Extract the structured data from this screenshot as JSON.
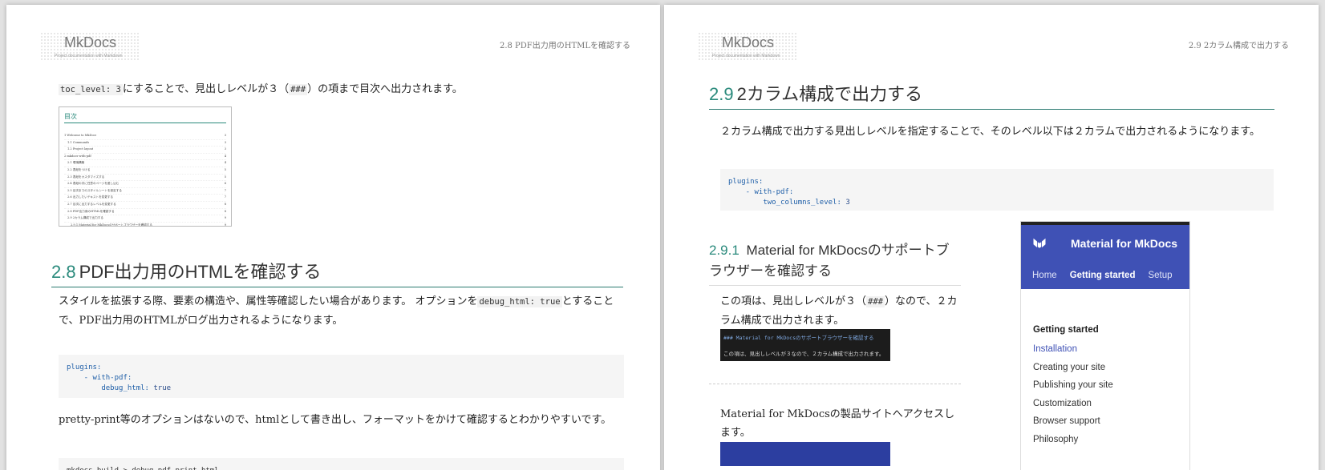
{
  "left_page": {
    "logo": {
      "title": "MkDocs",
      "subtitle": "Project documentation with Markdown"
    },
    "running_head": "2.8 PDF出力用のHTMLを確認する",
    "intro": {
      "code": "toc_level: 3",
      "text_a": "にすることで、見出しレベルが３（",
      "code2": "###",
      "text_b": "）の項まで目次へ出力されます。"
    },
    "toc_image": {
      "title": "目次",
      "rows": [
        {
          "t": "1 Welcome to MkDocs",
          "p": "3"
        },
        {
          "t": "1.1 Commands",
          "p": "3"
        },
        {
          "t": "1.2 Project layout",
          "p": "3"
        },
        {
          "t": "2 mkdocs-with-pdf",
          "p": "4"
        },
        {
          "t": "2.1 環境構築",
          "p": "4"
        },
        {
          "t": "2.2 表紙をつける",
          "p": "5"
        },
        {
          "t": "2.3 表紙をカスタマイズする",
          "p": "5"
        },
        {
          "t": "2.4 表紙の次に任意のページを差し込む",
          "p": "6"
        },
        {
          "t": "2.5 目次までのスタイルシートを設定する",
          "p": "7"
        },
        {
          "t": "2.6 出力したいテキストを変更する",
          "p": "7"
        },
        {
          "t": "2.7 目次に出力するレベルを変更する",
          "p": "8"
        },
        {
          "t": "2.8 PDF出力用のHTMLを確認する",
          "p": "8"
        },
        {
          "t": "2.9 2カラム構成で出力する",
          "p": "9"
        },
        {
          "t": "2.9.1 Material for MkDocsのサポートブラウザーを確認する",
          "p": "9"
        },
        {
          "t": "2.10 指定のページを2PDF出力対象から除外する",
          "p": "10"
        }
      ]
    },
    "section_28": {
      "num": "2.8",
      "title": "PDF出力用のHTMLを確認する",
      "p1_a": "スタイルを拡張する際、要素の構造や、属性等確認したい場合があります。 オプションを",
      "p1_code": "debug_html: true",
      "p1_b": "とすることで、PDF出力用のHTMLがログ出力されるようになります。",
      "code_l1": "plugins:",
      "code_l2": "    - with-pdf:",
      "code_l3_k": "        debug_html: ",
      "code_l3_v": "true",
      "p2": "pretty-print等のオプションはないので、htmlとして書き出し、フォーマットをかけて確認するとわかりやすいです。",
      "code2": "mkdocs build > debug_pdf_print.html"
    }
  },
  "right_page": {
    "logo": {
      "title": "MkDocs",
      "subtitle": "Project documentation with Markdown"
    },
    "running_head": "2.9 2カラム構成で出力する",
    "section_29": {
      "num": "2.9",
      "title": "2カラム構成で出力する",
      "p1": "２カラム構成で出力する見出しレベルを指定することで、そのレベル以下は２カラムで出力されるようになります。",
      "code_l1": "plugins:",
      "code_l2": "    - with-pdf:",
      "code_l3_k": "        two_columns_level: ",
      "code_l3_v": "3"
    },
    "section_291": {
      "num": "2.9.1",
      "title": "Material for MkDocsのサポートブラウザーを確認する",
      "p1_a": "この項は、見出しレベルが３（",
      "p1_code": "###",
      "p1_b": "）なので、２カラム構成で出力されます。",
      "term_l1": "### Material for MkDocsのサポートブラウザーを確認する",
      "term_l2": "この項は、見出しレベルが３なので、２カラム構成で出力されます。",
      "p2": "Material for MkDocsの製品サイトへアクセスします。"
    },
    "material_sample": {
      "title": "Material for MkDocs",
      "tabs": [
        "Home",
        "Getting started",
        "Setup"
      ],
      "nav_section": "Getting started",
      "nav_items": [
        "Installation",
        "Creating your site",
        "Publishing your site",
        "Customization",
        "Browser support",
        "Philosophy"
      ],
      "accent": "#3f51b5"
    }
  }
}
